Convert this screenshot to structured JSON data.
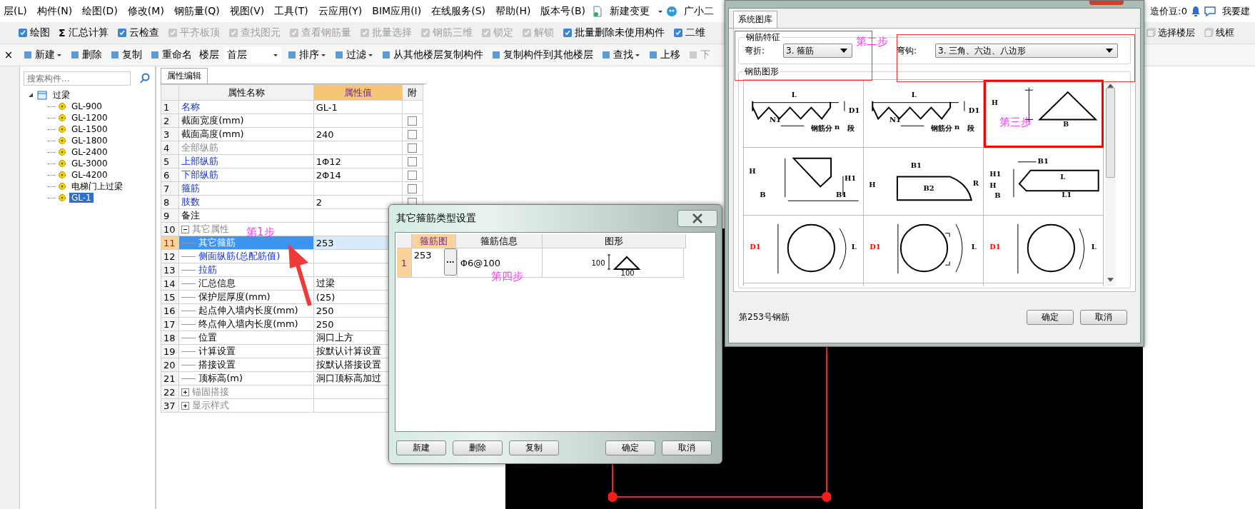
{
  "menu_bar": {
    "items": [
      {
        "label": "层(L)",
        "kind": "menu"
      },
      {
        "label": "构件(N)",
        "kind": "menu"
      },
      {
        "label": "绘图(D)",
        "kind": "menu"
      },
      {
        "label": "修改(M)",
        "kind": "menu"
      },
      {
        "label": "钢筋量(Q)",
        "kind": "menu"
      },
      {
        "label": "视图(V)",
        "kind": "menu"
      },
      {
        "label": "工具(T)",
        "kind": "menu"
      },
      {
        "label": "云应用(Y)",
        "kind": "menu"
      },
      {
        "label": "BIM应用(I)",
        "kind": "menu"
      },
      {
        "label": "在线服务(S)",
        "kind": "menu"
      },
      {
        "label": "帮助(H)",
        "kind": "menu"
      },
      {
        "label": "版本号(B)",
        "kind": "menu"
      },
      {
        "label": "新建变更",
        "kind": "dropdown"
      },
      {
        "label": "广小二",
        "kind": "assistant"
      }
    ],
    "account": [
      {
        "label": "造价豆:0",
        "kind": "plain"
      },
      {
        "kind": "bell"
      },
      {
        "label": "我要建",
        "kind": "chat"
      }
    ]
  },
  "toolbar_1": {
    "items": [
      {
        "label": "绘图",
        "disabled": false
      },
      {
        "label": "汇总计算",
        "glyph": "Σ",
        "disabled": false
      },
      {
        "label": "云检查",
        "disabled": false
      },
      {
        "label": "平齐板顶",
        "disabled": true
      },
      {
        "label": "查找图元",
        "disabled": true
      },
      {
        "label": "查看钢筋量",
        "disabled": true
      },
      {
        "label": "批量选择",
        "disabled": true
      },
      {
        "label": "钢筋三维",
        "disabled": true
      },
      {
        "label": "锁定",
        "disabled": true
      },
      {
        "label": "解锁",
        "disabled": true
      },
      {
        "label": "批量删除未使用构件",
        "disabled": false
      },
      {
        "label": "二维",
        "disabled": false
      }
    ],
    "right_items": [
      {
        "label": "选择楼层",
        "disabled": false
      },
      {
        "label": "线框",
        "disabled": false
      }
    ]
  },
  "toolbar_2": {
    "close": "×",
    "items": [
      {
        "label": "新建",
        "kind": "dropdown",
        "disabled": false
      },
      {
        "label": "删除",
        "kind": "button",
        "disabled": false
      },
      {
        "label": "复制",
        "kind": "button",
        "disabled": false
      },
      {
        "label": "重命名",
        "kind": "button",
        "disabled": false
      },
      {
        "label": "楼层",
        "kind": "label",
        "disabled": false
      },
      {
        "label": "首层",
        "kind": "select",
        "disabled": false
      },
      {
        "label": "排序",
        "kind": "dropdown",
        "disabled": false
      },
      {
        "label": "过滤",
        "kind": "dropdown",
        "disabled": false
      },
      {
        "label": "从其他楼层复制构件",
        "kind": "button",
        "disabled": false
      },
      {
        "label": "复制构件到其他楼层",
        "kind": "button",
        "disabled": false
      },
      {
        "label": "查找",
        "kind": "dropdown",
        "disabled": false
      },
      {
        "label": "上移",
        "kind": "button",
        "disabled": false
      },
      {
        "label": "下",
        "kind": "button",
        "disabled": true
      }
    ]
  },
  "component_tree": {
    "search": {
      "placeholder": "搜索构件..."
    },
    "nodes": [
      {
        "label": "过梁",
        "expanded": true,
        "selected": false,
        "children": [
          {
            "label": "GL-900",
            "selected": false
          },
          {
            "label": "GL-1200",
            "selected": false
          },
          {
            "label": "GL-1500",
            "selected": false
          },
          {
            "label": "GL-1800",
            "selected": false
          },
          {
            "label": "GL-2400",
            "selected": false
          },
          {
            "label": "GL-3000",
            "selected": false
          },
          {
            "label": "GL-4200",
            "selected": false
          },
          {
            "label": "电梯门上过梁",
            "selected": false
          },
          {
            "label": "GL-1",
            "selected": true
          }
        ]
      }
    ]
  },
  "property_editor": {
    "tab": "属性编辑",
    "columns": [
      "属性名称",
      "属性值",
      "附"
    ],
    "rows": [
      {
        "num": "1",
        "name": "名称",
        "value": "GL-1",
        "kind": "link",
        "selected": false
      },
      {
        "num": "2",
        "name": "截面宽度(mm)",
        "kind": "normal",
        "selected": false,
        "checked": false
      },
      {
        "num": "3",
        "name": "截面高度(mm)",
        "value": "240",
        "kind": "normal",
        "selected": false,
        "checked": false
      },
      {
        "num": "4",
        "name": "全部纵筋",
        "kind": "muted",
        "selected": false,
        "checked": false
      },
      {
        "num": "5",
        "name": "上部纵筋",
        "value": "1Φ12",
        "kind": "link",
        "selected": false,
        "checked": false
      },
      {
        "num": "6",
        "name": "下部纵筋",
        "value": "2Φ14",
        "kind": "link",
        "selected": false,
        "checked": false
      },
      {
        "num": "7",
        "name": "箍筋",
        "kind": "link",
        "selected": false,
        "checked": false
      },
      {
        "num": "8",
        "name": "肢数",
        "value": "2",
        "kind": "link",
        "selected": false,
        "checked": false
      },
      {
        "num": "9",
        "name": "备注",
        "kind": "normal",
        "selected": false
      },
      {
        "num": "10",
        "name": "其它属性",
        "kind": "muted",
        "selected": false,
        "expanded": true,
        "children": [
          {
            "num": "11",
            "name": "其它箍筋",
            "value": "253",
            "kind": "normal",
            "selected": true
          },
          {
            "num": "12",
            "name": "侧面纵筋(总配筋值)",
            "kind": "link",
            "selected": false
          },
          {
            "num": "13",
            "name": "拉筋",
            "kind": "link",
            "selected": false
          },
          {
            "num": "14",
            "name": "汇总信息",
            "value": "过梁",
            "kind": "normal",
            "selected": false
          },
          {
            "num": "15",
            "name": "保护层厚度(mm)",
            "value": "(25)",
            "kind": "normal",
            "selected": false
          },
          {
            "num": "16",
            "name": "起点伸入墙内长度(mm)",
            "value": "250",
            "kind": "normal",
            "selected": false
          },
          {
            "num": "17",
            "name": "终点伸入墙内长度(mm)",
            "value": "250",
            "kind": "normal",
            "selected": false
          },
          {
            "num": "18",
            "name": "位置",
            "value": "洞口上方",
            "kind": "normal",
            "selected": false
          },
          {
            "num": "19",
            "name": "计算设置",
            "value": "按默认计算设置",
            "kind": "normal",
            "selected": false
          },
          {
            "num": "20",
            "name": "搭接设置",
            "value": "按默认搭接设置",
            "kind": "normal",
            "selected": false
          },
          {
            "num": "21",
            "name": "顶标高(m)",
            "value": "洞口顶标高加过",
            "kind": "normal",
            "selected": false
          }
        ]
      },
      {
        "num": "22",
        "name": "锚固搭接",
        "kind": "muted",
        "selected": false,
        "expanded": false
      },
      {
        "num": "37",
        "name": "显示样式",
        "kind": "muted",
        "selected": false,
        "expanded": false
      }
    ]
  },
  "stirrup_dialog": {
    "title": "其它箍筋类型设置",
    "columns": [
      "箍筋图",
      "箍筋信息",
      "图形"
    ],
    "rows": [
      {
        "num": "1",
        "shape_no": "253",
        "browse": "···",
        "info": "Φ6@100",
        "height_label": "100",
        "width_label": "100"
      }
    ],
    "buttons": [
      {
        "label": "新建",
        "kind": "edit"
      },
      {
        "label": "删除",
        "kind": "edit"
      },
      {
        "label": "复制",
        "kind": "edit"
      },
      {
        "label": "确定",
        "kind": "confirm"
      },
      {
        "label": "取消",
        "kind": "confirm"
      }
    ]
  },
  "shape_dialog": {
    "tab": "系统图库",
    "features": {
      "title": "钢筋特征",
      "bend_label": "弯折:",
      "bend_value": "3. 箍筋",
      "hook_label": "弯钩:",
      "hook_value": "3. 三角、六边、八边形"
    },
    "gallery_title": "钢筋图形",
    "tiles": [
      {
        "kind": "zigzag",
        "selected": false,
        "labels": [
          {
            "text": "L"
          },
          {
            "text": "D1"
          },
          {
            "text": "N1"
          },
          {
            "text": "钢筋分"
          },
          {
            "text": "n"
          },
          {
            "text": "段"
          }
        ]
      },
      {
        "kind": "zigzag",
        "selected": false,
        "labels": [
          {
            "text": "L"
          },
          {
            "text": "D1"
          },
          {
            "text": "N1"
          },
          {
            "text": "钢筋分"
          },
          {
            "text": "n"
          },
          {
            "text": "段"
          }
        ]
      },
      {
        "kind": "triangle",
        "selected": true,
        "labels": [
          {
            "text": "H"
          },
          {
            "text": "B"
          }
        ]
      },
      {
        "kind": "wedge",
        "selected": false,
        "labels": [
          {
            "text": "H"
          },
          {
            "text": "B"
          },
          {
            "text": "H1"
          },
          {
            "text": "B1"
          }
        ]
      },
      {
        "kind": "rounded",
        "selected": false,
        "labels": [
          {
            "text": "B1"
          },
          {
            "text": "H"
          },
          {
            "text": "R"
          },
          {
            "text": "B2"
          }
        ]
      },
      {
        "kind": "arrowbox",
        "selected": false,
        "labels": [
          {
            "text": "B1"
          },
          {
            "text": "H1"
          },
          {
            "text": "H"
          },
          {
            "text": "B"
          },
          {
            "text": "L"
          },
          {
            "text": "L1"
          }
        ]
      },
      {
        "kind": "circle_two_hooks",
        "selected": false,
        "labels": [
          {
            "text": "D1",
            "color": "#ff0000"
          },
          {
            "text": "L"
          }
        ]
      },
      {
        "kind": "circle_outer_hooks",
        "selected": false,
        "labels": [
          {
            "text": "D1",
            "color": "#ff0000"
          },
          {
            "text": "L"
          }
        ]
      },
      {
        "kind": "circle",
        "selected": false,
        "labels": [
          {
            "text": "D1",
            "color": "#ff0000"
          },
          {
            "text": "L"
          }
        ]
      }
    ],
    "status": "第253号钢筋",
    "buttons": [
      "确定",
      "取消"
    ]
  },
  "annotations": [
    {
      "kind": "step",
      "text": "第1步"
    },
    {
      "kind": "step",
      "text": "第二步"
    },
    {
      "kind": "step",
      "text": "第三步"
    },
    {
      "kind": "step",
      "text": "第四步"
    },
    {
      "kind": "box"
    },
    {
      "kind": "box"
    },
    {
      "kind": "arrow"
    }
  ]
}
